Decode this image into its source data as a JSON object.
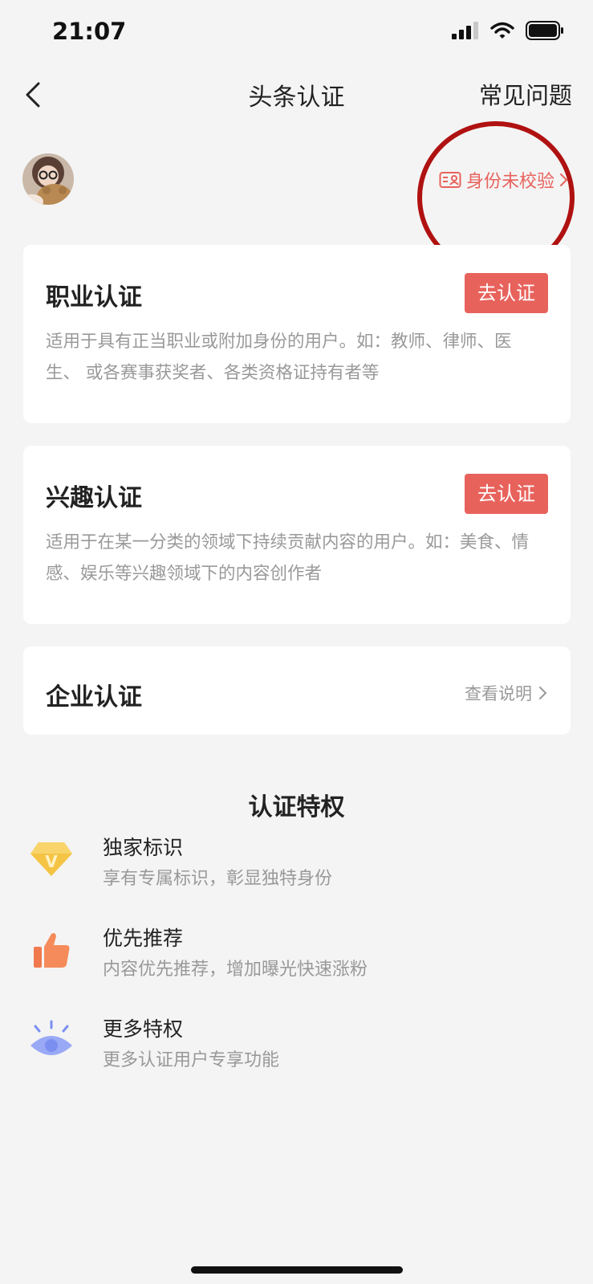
{
  "status_bar": {
    "time": "21:07"
  },
  "nav": {
    "title": "头条认证",
    "faq_label": "常见问题"
  },
  "profile": {
    "id_status": "身份未校验"
  },
  "cards": [
    {
      "title": "职业认证",
      "button": "去认证",
      "description": "适用于具有正当职业或附加身份的用户。如：教师、律师、医生、 或各赛事获奖者、各类资格证持有者等"
    },
    {
      "title": "兴趣认证",
      "button": "去认证",
      "description": "适用于在某一分类的领域下持续贡献内容的用户。如：美食、情感、娱乐等兴趣领域下的内容创作者"
    },
    {
      "title": "企业认证",
      "link": "查看说明"
    }
  ],
  "privileges": {
    "title": "认证特权",
    "items": [
      {
        "title": "独家标识",
        "desc": "享有专属标识，彰显独特身份",
        "icon": "diamond-v-icon"
      },
      {
        "title": "优先推荐",
        "desc": "内容优先推荐，增加曝光快速涨粉",
        "icon": "thumbs-up-icon"
      },
      {
        "title": "更多特权",
        "desc": "更多认证用户专享功能",
        "icon": "eye-icon"
      }
    ]
  },
  "colors": {
    "accent": "#e8625c",
    "annotation": "#b01111",
    "background": "#f4f4f4"
  }
}
